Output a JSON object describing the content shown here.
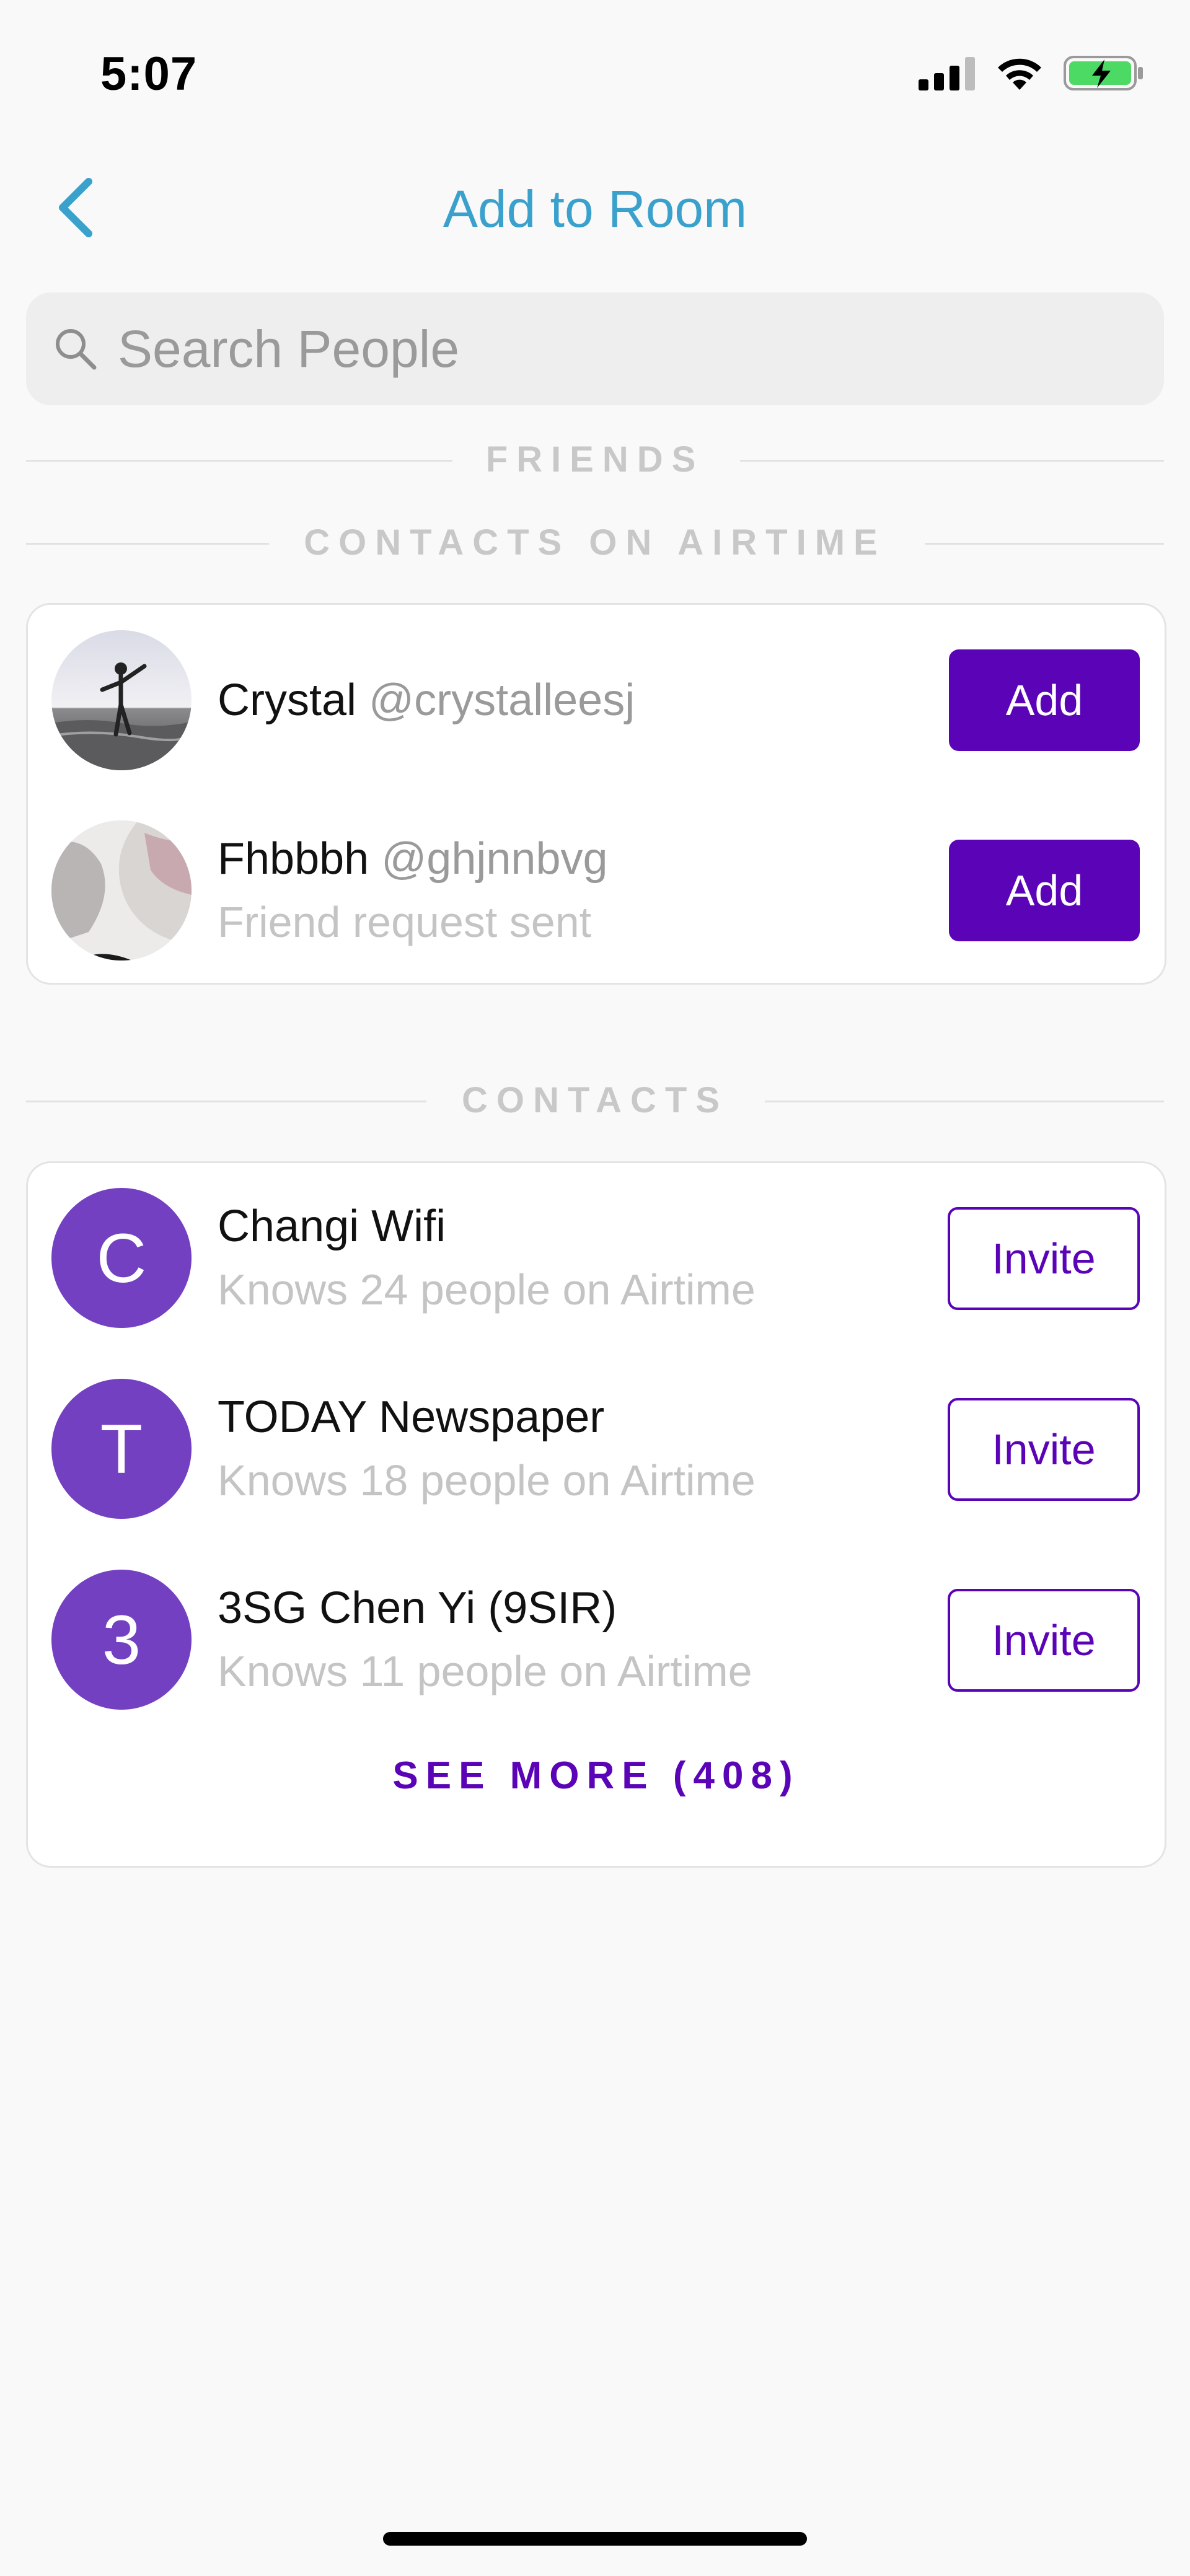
{
  "status_bar": {
    "time": "5:07"
  },
  "nav": {
    "title": "Add to Room"
  },
  "search": {
    "placeholder": "Search People"
  },
  "sections": {
    "friends": "FRIENDS",
    "contacts_on_airtime": "CONTACTS ON AIRTIME",
    "contacts": "CONTACTS"
  },
  "airtime_contacts": [
    {
      "name": "Crystal",
      "handle": "@crystalleesj",
      "status": "",
      "action": "Add"
    },
    {
      "name": "Fhbbbh",
      "handle": "@ghjnnbvg",
      "status": "Friend request sent",
      "action": "Add"
    }
  ],
  "contacts": [
    {
      "initial": "C",
      "name": "Changi Wifi",
      "detail": "Knows 24 people on Airtime",
      "action": "Invite"
    },
    {
      "initial": "T",
      "name": "TODAY Newspaper",
      "detail": "Knows 18 people on Airtime",
      "action": "Invite"
    },
    {
      "initial": "3",
      "name": "3SG Chen Yi (9SIR)",
      "detail": "Knows 11 people on Airtime",
      "action": "Invite"
    }
  ],
  "see_more": "SEE MORE (408)",
  "colors": {
    "accent": "#5b04b7",
    "title_blue": "#3aa0cc",
    "avatar_purple": "#7440c2",
    "battery_green": "#4cd964"
  }
}
